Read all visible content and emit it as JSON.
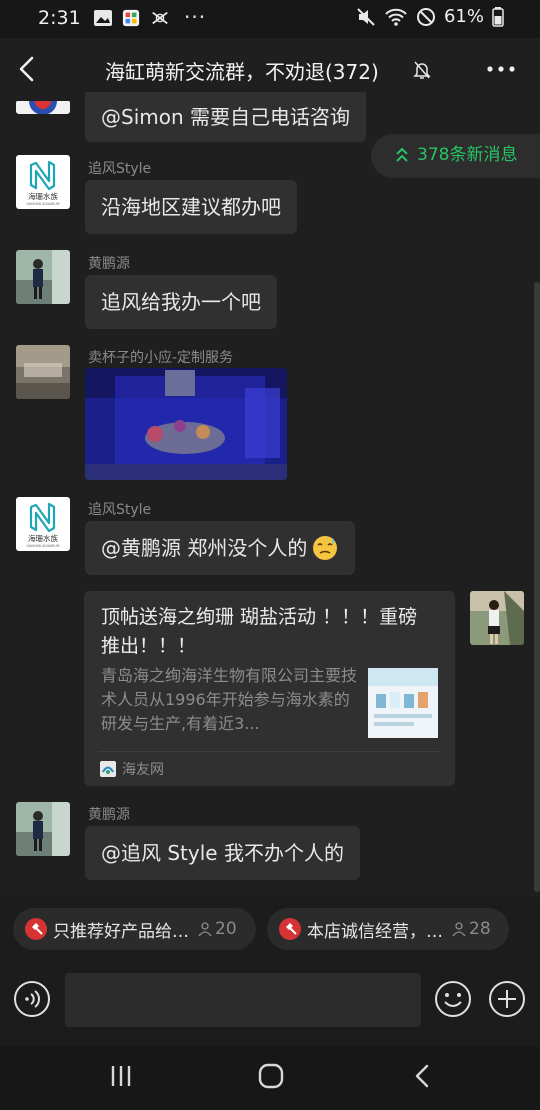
{
  "status_bar": {
    "time": "2:31",
    "dots": "···",
    "battery": "61%"
  },
  "header": {
    "title": "海缸萌新交流群，不劝退(372)"
  },
  "new_messages": {
    "label": "378条新消息"
  },
  "messages": [
    {
      "text": "@Simon  需要自己电话咨询"
    },
    {
      "sender": "追风Style",
      "text": "沿海地区建议都办吧"
    },
    {
      "sender": "黄鹏源",
      "text": "追风给我办一个吧"
    },
    {
      "sender": "卖杯子的小应-定制服务"
    },
    {
      "sender": "追风Style",
      "text": "@黄鹏源  郑州没个人的"
    },
    {
      "sender": "黄鹏源",
      "text": "@追风 Style  我不办个人的"
    }
  ],
  "avatars": {
    "brand": "海珊水族",
    "brand_sub": "HAISHAN AQUARIUM"
  },
  "shared_card": {
    "title": "顶帖送海之绚珊 瑚盐活动 ！！！重磅推出！！！",
    "description": "青岛海之绚海洋生物有限公司主要技术人员从1996年开始参与海水素的研发与生产,有着近3...",
    "source": "海友网"
  },
  "chips": [
    {
      "label": "只推荐好产品给…",
      "count": "20"
    },
    {
      "label": "本店诚信经营，…",
      "count": "28"
    }
  ],
  "colors": {
    "accent_green": "#27c365",
    "background": "#1f1f1f",
    "bubble": "#303030",
    "hammer_red": "#d63434"
  }
}
